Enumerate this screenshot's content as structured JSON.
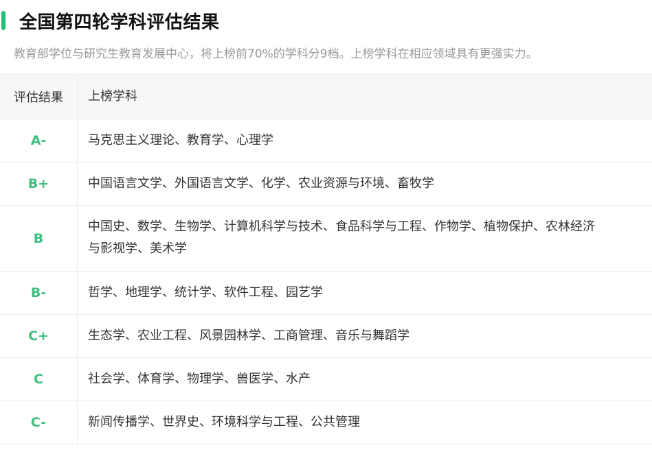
{
  "header": {
    "title": "全国第四轮学科评估结果",
    "subtitle": "教育部学位与研究生教育发展中心，将上榜前70%的学科分9档。上榜学科在相应领域具有更强实力。"
  },
  "colors": {
    "accent": "#1fbf76",
    "grade_text": "#3dbf7f"
  },
  "table": {
    "columns": [
      "评估结果",
      "上榜学科"
    ],
    "rows": [
      {
        "grade": "A-",
        "subjects": "马克思主义理论、教育学、心理学"
      },
      {
        "grade": "B+",
        "subjects": "中国语言文学、外国语言文学、化学、农业资源与环境、畜牧学"
      },
      {
        "grade": "B",
        "subjects_line1": "中国史、数学、生物学、计算机科学与技术、食品科学与工程、作物学、植物保护、农林经济",
        "subjects_line2": "与影视学、美术学"
      },
      {
        "grade": "B-",
        "subjects": "哲学、地理学、统计学、软件工程、园艺学"
      },
      {
        "grade": "C+",
        "subjects": "生态学、农业工程、风景园林学、工商管理、音乐与舞蹈学"
      },
      {
        "grade": "C",
        "subjects": "社会学、体育学、物理学、兽医学、水产"
      },
      {
        "grade": "C-",
        "subjects": "新闻传播学、世界史、环境科学与工程、公共管理"
      }
    ]
  }
}
